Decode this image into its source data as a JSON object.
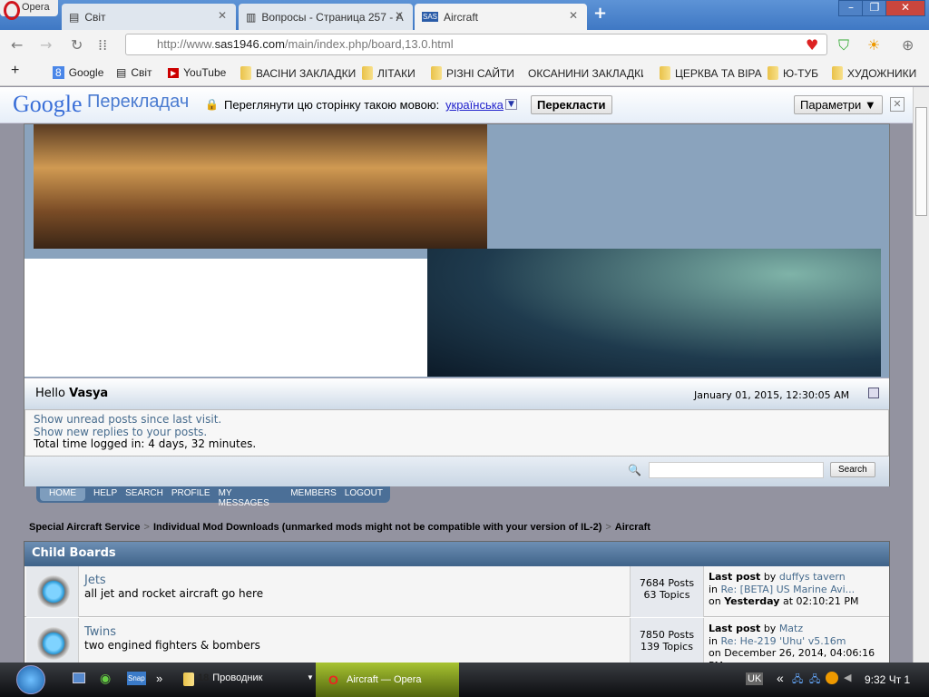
{
  "browser": {
    "opera_label": "Opera",
    "tabs": [
      {
        "title": "Світ"
      },
      {
        "title": "Вопросы - Страница 257 - A"
      },
      {
        "title": "Aircraft",
        "active": true
      }
    ],
    "url_prefix": "http://www.",
    "url_domain": "sas1946.com",
    "url_path": "/main/index.php/board,13.0.html",
    "bookmarks": [
      "Google",
      "Світ",
      "YouTube",
      "ВАСІНИ ЗАКЛАДКИ",
      "ЛІТАКИ",
      "РІЗНІ САЙТИ",
      "ОКСАНИНИ ЗАКЛАДКИ",
      "ЦЕРКВА ТА ВІРА",
      "Ю-ТУБ",
      "ХУДОЖНИКИ"
    ]
  },
  "translate": {
    "logo_google": "Google",
    "logo_text": "Перекладач",
    "prompt": "Переглянути цю сторінку такою мовою:",
    "language": "українська",
    "translate_button": "Перекласти",
    "options_button": "Параметри ▼"
  },
  "forum": {
    "hello": "Hello",
    "username": "Vasya",
    "datetime": "January 01, 2015, 12:30:05 AM",
    "unread": "Show unread posts since last visit.",
    "replies": "Show new replies to your posts.",
    "time_logged": "Total time logged in: 4 days, 32 minutes.",
    "search_button": "Search",
    "menu": [
      "HOME",
      "HELP",
      "SEARCH",
      "PROFILE",
      "MY MESSAGES",
      "MEMBERS",
      "LOGOUT"
    ],
    "breadcrumb": [
      "Special Aircraft Service",
      "Individual Mod Downloads (unmarked mods might not be compatible with your version of IL-2)",
      "Aircraft"
    ],
    "child_boards_title": "Child Boards",
    "boards": [
      {
        "name": "Jets",
        "desc": "all jet and rocket aircraft go here",
        "posts": "7684 Posts",
        "topics": "63 Topics",
        "last_label": "Last post",
        "by": "by",
        "author": "duffys tavern",
        "in": "in",
        "topic": "Re: [BETA] US Marine Avi...",
        "on": "on",
        "date_bold": "Yesterday",
        "date_rest": "at 02:10:21 PM"
      },
      {
        "name": "Twins",
        "desc": "two engined fighters & bombers",
        "posts": "7850 Posts",
        "topics": "139 Topics",
        "last_label": "Last post",
        "by": "by",
        "author": "Matz",
        "in": "in",
        "topic": "Re: He-219 'Uhu' v5.16m",
        "on": "on",
        "date_bold": "",
        "date_rest": "December 26, 2014, 04:06:16 PM"
      }
    ]
  },
  "taskbar": {
    "explorer_count": "18",
    "explorer_label": "Проводник",
    "opera_task": "Aircraft — Opera",
    "lang": "UK",
    "clock": "9:32 Чт 1"
  }
}
